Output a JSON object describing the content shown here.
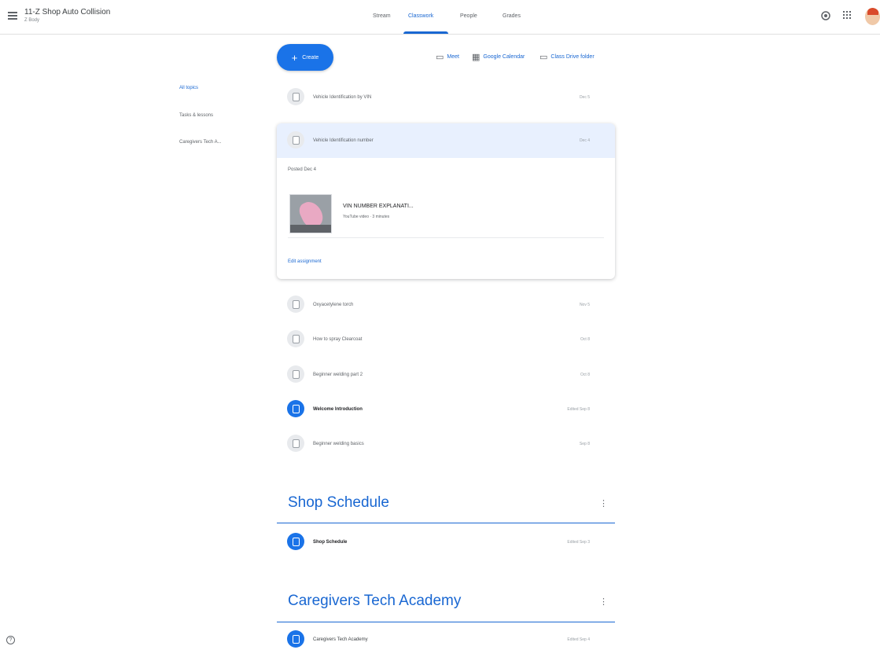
{
  "header": {
    "class_title": "11-Z Shop Auto Collision",
    "class_subtitle": "Z Body",
    "tabs": [
      {
        "label": "Stream"
      },
      {
        "label": "Classwork"
      },
      {
        "label": "People"
      },
      {
        "label": "Grades"
      }
    ],
    "icons": [
      "menu-icon",
      "settings-icon",
      "apps-grid-icon",
      "avatar"
    ]
  },
  "toolbar": {
    "create_label": "Create",
    "meet_label": "Meet",
    "calendar_label": "Google Calendar",
    "drive_label": "Class Drive folder"
  },
  "sidenav": {
    "items": [
      {
        "label": "All topics"
      },
      {
        "label": "Tasks & lessons"
      },
      {
        "label": "Caregivers Tech A..."
      }
    ]
  },
  "classwork": {
    "rows_top": [
      {
        "title": "Vehicle Identification by VIN",
        "date": "Dec 5"
      }
    ],
    "expanded": {
      "title": "Vehicle Identification number",
      "date": "Dec 4",
      "posted": "Posted Dec 4",
      "attachment_title": "VIN NUMBER EXPLANATI...",
      "attachment_sub": "YouTube video · 3 minutes",
      "edit_label": "Edit assignment"
    },
    "rows_bottom": [
      {
        "title": "Oxyacetylene torch",
        "date": "Nov 5",
        "highlight": false
      },
      {
        "title": "How to spray Clearcoat",
        "date": "Oct 8",
        "highlight": false
      },
      {
        "title": "Beginner welding part 2",
        "date": "Oct 8",
        "highlight": false
      },
      {
        "title": "Welcome Introduction",
        "date": "Edited Sep 8",
        "highlight": true
      },
      {
        "title": "Beginner welding basics",
        "date": "Sep 8",
        "highlight": false
      }
    ]
  },
  "sections": [
    {
      "title": "Shop Schedule",
      "item": "Shop Schedule",
      "item_date": "Edited Sep 3"
    },
    {
      "title": "Caregivers Tech Academy",
      "item": "Caregivers Tech Academy",
      "item_date": "Edited Sep 4"
    }
  ],
  "colors": {
    "accent": "#1a73e8",
    "accent_text": "#1967d2",
    "row_highlight": "#e8f0fe"
  }
}
